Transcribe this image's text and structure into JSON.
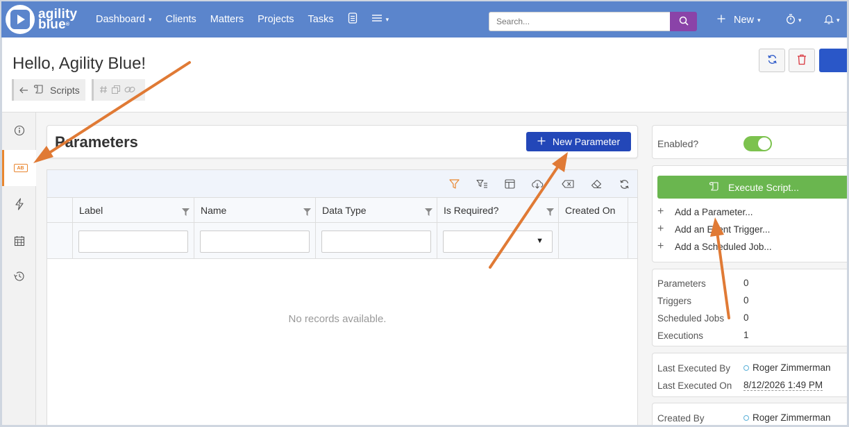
{
  "nav": {
    "logo_line1": "agility",
    "logo_line2": "blue",
    "logo_reg": "®",
    "items": [
      {
        "label": "Dashboard",
        "caret": "▾"
      },
      {
        "label": "Clients"
      },
      {
        "label": "Matters"
      },
      {
        "label": "Projects"
      },
      {
        "label": "Tasks"
      }
    ],
    "search_placeholder": "Search...",
    "new_label": "New",
    "caret": "▾",
    "icons": [
      "document-icon",
      "list-menu-icon",
      "search-icon",
      "plus-icon",
      "stopwatch-icon",
      "bell-icon"
    ]
  },
  "header": {
    "title": "Hello, Agility Blue!",
    "breadcrumb_label": "Scripts",
    "icons": [
      "back-arrow-icon",
      "script-icon",
      "hash-icon",
      "copy-icon",
      "link-icon",
      "refresh-icon",
      "delete-icon"
    ]
  },
  "rail": {
    "icons": [
      "info-icon",
      "parameters-icon",
      "trigger-icon",
      "calendar-icon",
      "history-icon"
    ],
    "active": "parameters-icon",
    "ab_text": "AB"
  },
  "params": {
    "title": "Parameters",
    "new_button": "New Parameter",
    "columns": [
      "Label",
      "Name",
      "Data Type",
      "Is Required?",
      "Created On"
    ],
    "dropdown_arrow": "▼",
    "empty_text": "No records available.",
    "toolbar_icons": [
      "filter-icon",
      "filter-list-icon",
      "columns-icon",
      "download-icon",
      "clear-icon",
      "eraser-icon",
      "refresh-icon"
    ]
  },
  "right": {
    "enabled_label": "Enabled?",
    "enabled": true,
    "execute_label": "Execute Script...",
    "actions": [
      "Add a Parameter...",
      "Add an Event Trigger...",
      "Add a Scheduled Job..."
    ],
    "stats": [
      {
        "label": "Parameters",
        "value": "0"
      },
      {
        "label": "Triggers",
        "value": "0"
      },
      {
        "label": "Scheduled Jobs",
        "value": "0"
      },
      {
        "label": "Executions",
        "value": "1"
      }
    ],
    "last_executed_by_label": "Last Executed By",
    "last_executed_by": "Roger Zimmerman",
    "last_executed_on_label": "Last Executed On",
    "last_executed_on": "8/12/2026 1:49 PM",
    "created_by_label": "Created By",
    "created_by": "Roger Zimmerman"
  },
  "colors": {
    "nav": "#5b85cc",
    "search_button": "#8a43a8",
    "primary": "#2347b8",
    "success": "#6ab64f",
    "toggle_on": "#7cc24e",
    "accent_orange": "#e9862f",
    "annotation_arrow": "#e07a35"
  }
}
